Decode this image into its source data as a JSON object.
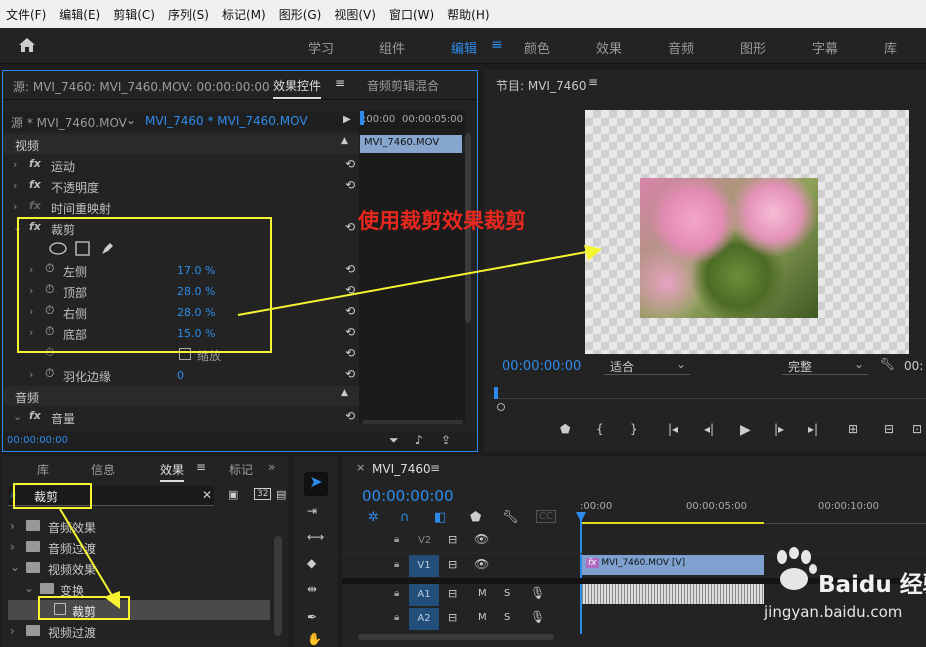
{
  "menu": [
    "文件(F)",
    "编辑(E)",
    "剪辑(C)",
    "序列(S)",
    "标记(M)",
    "图形(G)",
    "视图(V)",
    "窗口(W)",
    "帮助(H)"
  ],
  "workspaces": [
    "学习",
    "组件",
    "编辑",
    "颜色",
    "效果",
    "音频",
    "图形",
    "字幕",
    "库"
  ],
  "active_workspace": "编辑",
  "source_panel": {
    "tab_source": "源: MVI_7460: MVI_7460.MOV: 00:00:00:00",
    "tab_effect_controls": "效果控件",
    "tab_audio_mixer": "音频剪辑混合",
    "clip_selector": "源 * MVI_7460.MOV",
    "sequence_clip": "MVI_7460 * MVI_7460.MOV",
    "mini_timeline_t0": ":00:00",
    "mini_timeline_t1": "00:00:05:00",
    "mini_clip": "MVI_7460.MOV",
    "video_header": "视频",
    "audio_header": "音频",
    "effects": [
      {
        "name": "运动"
      },
      {
        "name": "不透明度"
      },
      {
        "name": "时间重映射"
      },
      {
        "name": "裁剪"
      }
    ],
    "crop_params": [
      {
        "name": "左侧",
        "value": "17.0 %"
      },
      {
        "name": "顶部",
        "value": "28.0 %"
      },
      {
        "name": "右侧",
        "value": "28.0 %"
      },
      {
        "name": "底部",
        "value": "15.0 %"
      }
    ],
    "zoom_label": "缩放",
    "feather_label": "羽化边缘",
    "feather_value": "0",
    "volume_label": "音量",
    "timecode": "00:00:00:00"
  },
  "annotation": "使用裁剪效果裁剪",
  "program": {
    "title": "节目: MVI_7460",
    "timecode": "00:00:00:00",
    "fit": "适合",
    "quality": "完整",
    "timecode_right": "00:"
  },
  "project_panel": {
    "tabs": [
      "库",
      "信息",
      "效果",
      "标记"
    ],
    "active_tab": "效果",
    "search_value": "裁剪",
    "tree": [
      {
        "label": "音频效果",
        "level": 0
      },
      {
        "label": "音频过渡",
        "level": 0
      },
      {
        "label": "视频效果",
        "level": 0
      },
      {
        "label": "变换",
        "level": 1
      },
      {
        "label": "裁剪",
        "level": 2
      },
      {
        "label": "视频过渡",
        "level": 0
      }
    ]
  },
  "timeline": {
    "title": "MVI_7460",
    "timecode": "00:00:00:00",
    "ruler": [
      ":00:00",
      "00:00:05:00",
      "00:00:10:00"
    ],
    "tracks": [
      {
        "id": "V2",
        "target": ""
      },
      {
        "id": "V1",
        "target": "V1"
      },
      {
        "id": "A1",
        "target": "A1"
      },
      {
        "id": "A2",
        "target": "A2"
      }
    ],
    "video_clip": "MVI_7460.MOV [V]",
    "m_label": "M",
    "s_label": "S"
  },
  "watermark": {
    "brand": "Baidu 经验",
    "url": "jingyan.baidu.com"
  }
}
